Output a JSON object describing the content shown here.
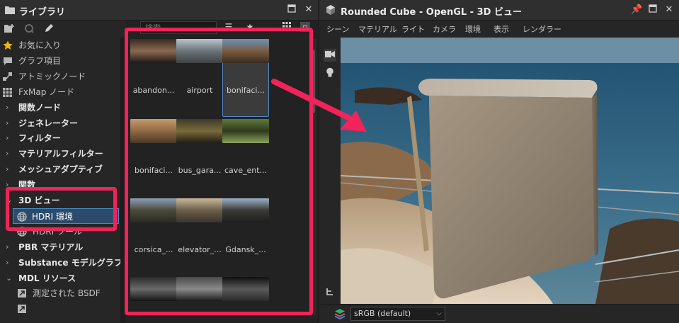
{
  "library": {
    "title": "ライブラリ",
    "search_placeholder": "検索",
    "tree": [
      {
        "label": "お気に入り",
        "icon": "star-icon",
        "type": "item"
      },
      {
        "label": "グラフ項目",
        "icon": "comment-icon",
        "type": "item"
      },
      {
        "label": "アトミックノード",
        "icon": "atomic-node-icon",
        "type": "item"
      },
      {
        "label": "FxMap ノード",
        "icon": "grid-icon",
        "type": "item"
      },
      {
        "label": "関数ノード",
        "type": "cat"
      },
      {
        "label": "ジェネレーター",
        "type": "cat"
      },
      {
        "label": "フィルター",
        "type": "cat"
      },
      {
        "label": "マテリアルフィルター",
        "type": "cat"
      },
      {
        "label": "メッシュアダプティブ",
        "type": "cat"
      },
      {
        "label": "関数",
        "type": "cat"
      },
      {
        "label": "3D ビュー",
        "type": "cat-open"
      },
      {
        "label": "HDRI 環境",
        "icon": "globe-icon",
        "type": "sub-selected"
      },
      {
        "label": "HDRI ツール",
        "icon": "globe-icon",
        "type": "sub"
      },
      {
        "label": "PBR マテリアル",
        "type": "cat"
      },
      {
        "label": "Substance モデルグラフ",
        "type": "cat"
      },
      {
        "label": "MDL リソース",
        "type": "cat-open"
      },
      {
        "label": "測定された BSDF",
        "icon": "link-icon",
        "type": "sub"
      },
      {
        "label": "",
        "icon": "link-icon",
        "type": "sub"
      }
    ],
    "thumbnails": [
      {
        "label": "abandon...",
        "colors": [
          "#3a2a22",
          "#8a6a50",
          "#1c1a18"
        ]
      },
      {
        "label": "airport",
        "colors": [
          "#b8c4cc",
          "#6b7479",
          "#3d4245"
        ]
      },
      {
        "label": "bonifaci...",
        "colors": [
          "#6d8fb8",
          "#7a5c40",
          "#3a2c20"
        ]
      },
      {
        "label": "bonifaci...",
        "colors": [
          "#c69a6a",
          "#8e6a44",
          "#4a3826"
        ]
      },
      {
        "label": "bus_gara...",
        "colors": [
          "#3d3a2a",
          "#7a6a3a",
          "#1f1d16"
        ]
      },
      {
        "label": "cave_ent...",
        "colors": [
          "#5f7a3a",
          "#2f3a1d",
          "#8aa25a"
        ]
      },
      {
        "label": "corsica_...",
        "colors": [
          "#8aa0b8",
          "#4a4a3a",
          "#2a2a24"
        ]
      },
      {
        "label": "elevator_...",
        "colors": [
          "#c9b89a",
          "#6a5e4a",
          "#3a342a"
        ]
      },
      {
        "label": "Gdansk_...",
        "colors": [
          "#9ab0c8",
          "#3a3a34",
          "#1e1e1c"
        ]
      },
      {
        "label": "",
        "colors": [
          "#2a2a2a",
          "#6a6a6a",
          "#141414"
        ]
      },
      {
        "label": "",
        "colors": [
          "#4a4a4a",
          "#8a8a8a",
          "#1c1c1c"
        ]
      },
      {
        "label": "",
        "colors": [
          "#0f0f0f",
          "#5a5a5a",
          "#2a2a2a"
        ]
      }
    ]
  },
  "view3d": {
    "title": "Rounded Cube - OpenGL - 3D ビュー",
    "menu": [
      "シーン",
      "マテリアル",
      "ライト",
      "カメラ",
      "環境",
      "表示",
      "レンダラー"
    ],
    "color_space": "sRGB (default)"
  },
  "colors": {
    "highlight": "#f0245a",
    "selection": "#4a8ac6"
  }
}
